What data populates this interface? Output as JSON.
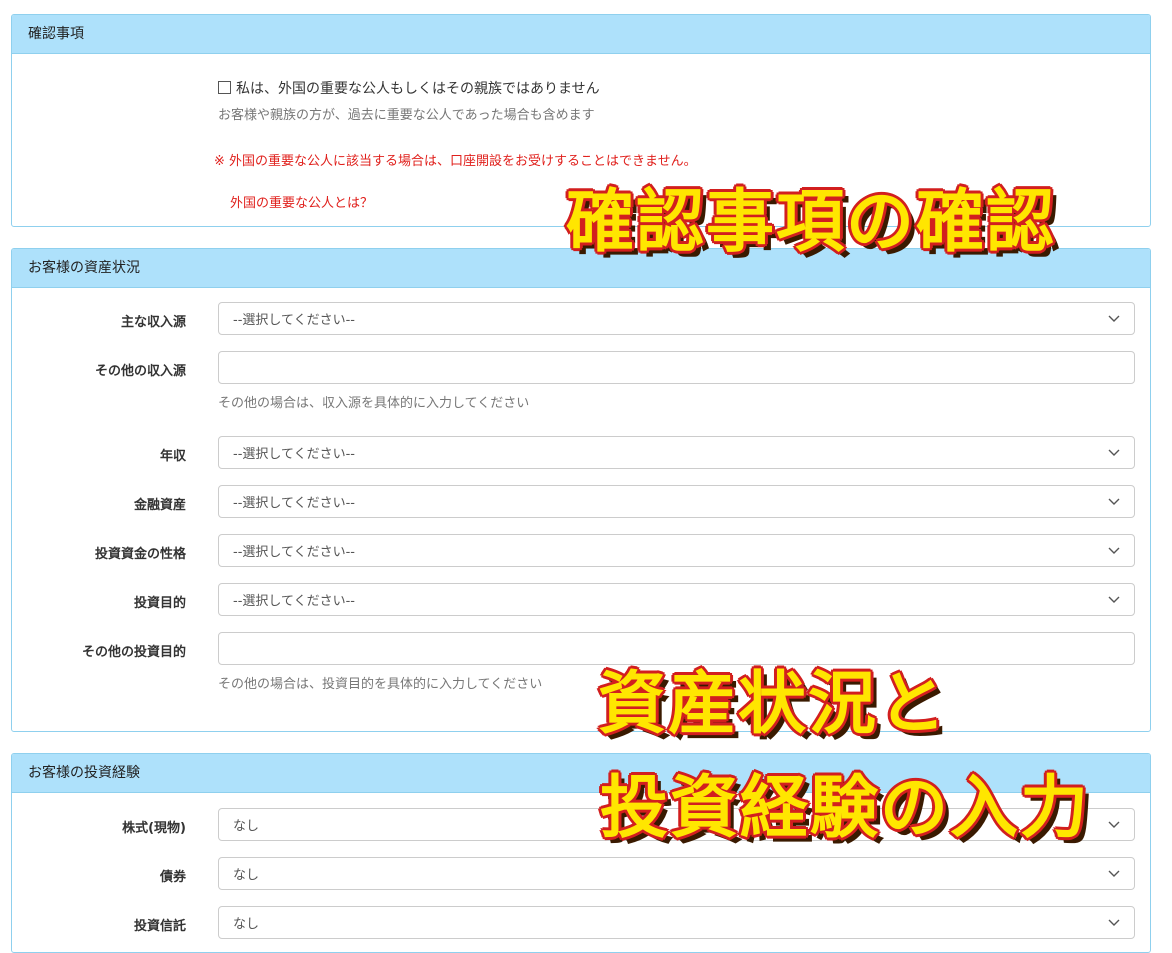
{
  "confirm": {
    "header": "確認事項",
    "checkbox_label": "私は、外国の重要な公人もしくはその親族ではありません",
    "help": "お客様や親族の方が、過去に重要な公人であった場合も含めます",
    "warning": "※ 外国の重要な公人に該当する場合は、口座開設をお受けすることはできません。",
    "link": "外国の重要な公人とは？"
  },
  "assets": {
    "header": "お客様の資産状況",
    "main_income": {
      "label": "主な収入源",
      "value": "--選択してください--"
    },
    "other_income": {
      "label": "その他の収入源",
      "value": "",
      "help": "その他の場合は、収入源を具体的に入力してください"
    },
    "annual_income": {
      "label": "年収",
      "value": "--選択してください--"
    },
    "financial_assets": {
      "label": "金融資産",
      "value": "--選択してください--"
    },
    "fund_nature": {
      "label": "投資資金の性格",
      "value": "--選択してください--"
    },
    "purpose": {
      "label": "投資目的",
      "value": "--選択してください--"
    },
    "other_purpose": {
      "label": "その他の投資目的",
      "value": "",
      "help": "その他の場合は、投資目的を具体的に入力してください"
    }
  },
  "experience": {
    "header": "お客様の投資経験",
    "stocks": {
      "label": "株式(現物)",
      "value": "なし"
    },
    "bonds": {
      "label": "債券",
      "value": "なし"
    },
    "funds": {
      "label": "投資信託",
      "value": "なし"
    }
  },
  "overlays": {
    "caption1": "確認事項の確認",
    "caption2_line1": "資産状況と",
    "caption2_line2": "投資経験の入力"
  },
  "colors": {
    "header_bg": "#aee1fb",
    "warning_red": "#e0201c",
    "overlay_fill": "#ffe600",
    "overlay_stroke": "#d21f1f"
  }
}
